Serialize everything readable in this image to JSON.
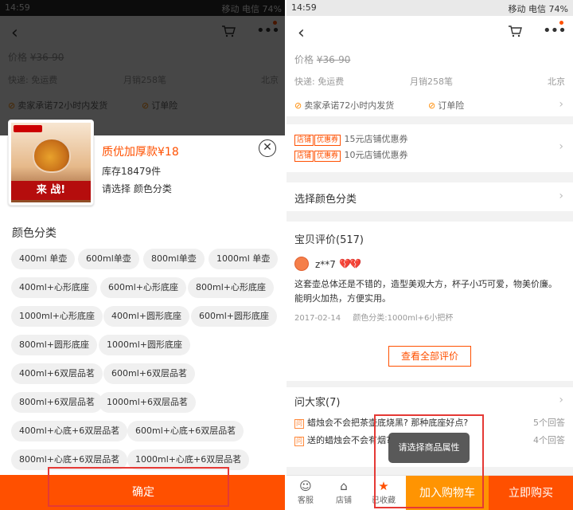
{
  "status_bar": {
    "time": "14:59",
    "carrier": "移动 电信 74%"
  },
  "product": {
    "price_label": "价格",
    "price_orig": "¥36-90",
    "shipping": "快递: 免运费",
    "sales": "月销258笔",
    "location": "北京",
    "promise_ship": "卖家承诺72小时内发货",
    "promise_insurance": "订单险"
  },
  "coupons": [
    {
      "tags": [
        "店铺",
        "优惠券"
      ],
      "text": "15元店铺优惠券"
    },
    {
      "tags": [
        "店铺",
        "优惠券"
      ],
      "text": "10元店铺优惠券"
    }
  ],
  "select_color": "选择颜色分类",
  "reviews": {
    "header": "宝贝评价(517)",
    "user": "z**7",
    "hearts": "💔💔",
    "body": "这套壶总体还是不错的，造型美观大方，杯子小巧可爱，物美价廉。能明火加热，方便实用。",
    "date": "2017-02-14",
    "spec": "颜色分类:1000ml+6小把杯",
    "view_all": "查看全部评价"
  },
  "qa": {
    "header": "问大家(7)",
    "items": [
      {
        "icon": "问",
        "q": "蜡烛会不会把茶壶底烧黑? 那种底座好点?",
        "count": "5个回答"
      },
      {
        "icon": "问",
        "q": "送的蜡烛会不会有烟?",
        "count": "4个回答"
      }
    ]
  },
  "toast": "请选择商品属性",
  "bottom_bar": {
    "service": "客服",
    "shop": "店铺",
    "fav": "已收藏",
    "add_cart": "加入购物车",
    "buy_now": "立即购买"
  },
  "sku_sheet": {
    "title": "质优加厚款¥18",
    "stock": "库存18479件",
    "select_hint": "请选择 颜色分类",
    "image_banner": "来 战!",
    "category_title": "颜色分类",
    "options": [
      "400ml 单壶",
      "600ml单壶",
      "800ml单壶",
      "1000ml 单壶",
      "400ml+心形底座",
      "600ml+心形底座",
      "800ml+心形底座",
      "1000ml+心形底座",
      "400ml+圆形底座",
      "600ml+圆形底座",
      "800ml+圆形底座",
      "1000ml+圆形底座",
      "400ml+6双层品茗",
      "600ml+6双层品茗",
      "800ml+6双层品茗",
      "1000ml+6双层品茗",
      "400ml+心底+6双层品茗",
      "600ml+心底+6双层品茗",
      "800ml+心底+6双层品茗",
      "1000ml+心底+6双层品茗"
    ],
    "confirm": "确定"
  },
  "colors": {
    "accent": "#ff5000",
    "cart": "#ff9402",
    "annotation": "#e53935"
  }
}
